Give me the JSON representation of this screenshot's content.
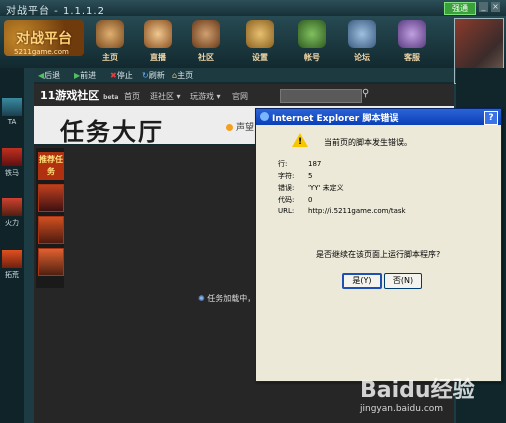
{
  "window": {
    "title": "对战平台 - 1.1.1.2",
    "signal": "强通"
  },
  "header": {
    "logo": "对战平台",
    "logo_sub": "5211game.com",
    "nav": [
      {
        "label": "主页",
        "icon": "home-icon"
      },
      {
        "label": "直播",
        "icon": "live-icon"
      },
      {
        "label": "社区",
        "icon": "community-icon"
      },
      {
        "label": "设置",
        "icon": "gear-icon"
      },
      {
        "label": "帐号",
        "icon": "account-icon"
      },
      {
        "label": "论坛",
        "icon": "forum-icon"
      },
      {
        "label": "客服",
        "icon": "support-icon"
      }
    ]
  },
  "left_sidebar": [
    "TA",
    "铁马",
    "火力",
    "拓荒"
  ],
  "toolbar": {
    "back": "后退",
    "forward": "前进",
    "stop": "停止",
    "refresh": "刷新",
    "home": "主页"
  },
  "site": {
    "logo": "11游戏社区",
    "beta": "beta",
    "nav": [
      "首页",
      "逛社区 ▾",
      "玩游戏 ▾",
      "官网"
    ]
  },
  "banner": {
    "title": "任务大厅",
    "bulletin": "声望"
  },
  "left_menu": [
    "推荐任务",
    "",
    "",
    ""
  ],
  "loading": "任务加载中，请稍后...",
  "dialog": {
    "title": "Internet Explorer 脚本错误",
    "message": "当前页的脚本发生错误。",
    "rows": [
      {
        "k": "行:",
        "v": "187"
      },
      {
        "k": "字符:",
        "v": "5"
      },
      {
        "k": "错误:",
        "v": "'YY' 未定义"
      },
      {
        "k": "代码:",
        "v": "0"
      },
      {
        "k": "URL:",
        "v": "http://i.5211game.com/task"
      }
    ],
    "question": "是否继续在该页面上运行脚本程序?",
    "yes": "是(Y)",
    "no": "否(N)"
  },
  "watermark": {
    "text": "Baidu经验",
    "url": "jingyan.baidu.com"
  }
}
